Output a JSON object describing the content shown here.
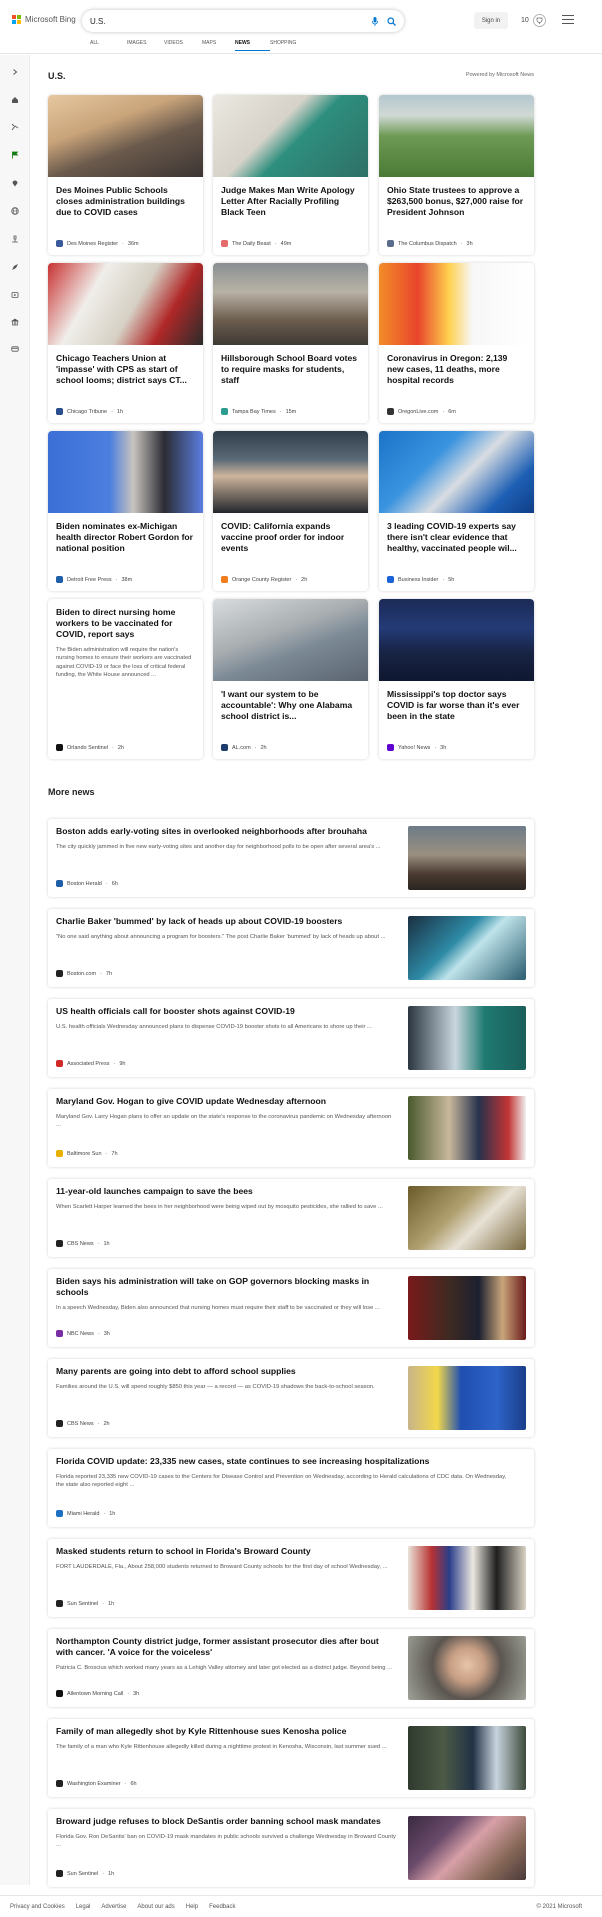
{
  "header": {
    "brand": "Microsoft Bing",
    "search_value": "U.S.",
    "signin": "Sign in",
    "rewards": "10"
  },
  "nav": [
    "ALL",
    "IMAGES",
    "VIDEOS",
    "MAPS",
    "NEWS",
    "SHOPPING"
  ],
  "section": {
    "title": "U.S.",
    "powered": "Powered by Microsoft News"
  },
  "cards": [
    {
      "title": "Des Moines Public Schools closes administration buildings due to COVID cases",
      "source": "Des Moines Register",
      "time": "36m"
    },
    {
      "title": "Judge Makes Man Write Apology Letter After Racially Profiling Black Teen",
      "source": "The Daily Beast",
      "time": "49m"
    },
    {
      "title": "Ohio State trustees to approve a $263,500 bonus, $27,000 raise for President Johnson",
      "source": "The Columbus Dispatch",
      "time": "3h"
    },
    {
      "title": "Chicago Teachers Union at 'impasse' with CPS as start of school looms; district says CT...",
      "source": "Chicago Tribune",
      "time": "1h"
    },
    {
      "title": "Hillsborough School Board votes to require masks for students, staff",
      "source": "Tampa Bay Times",
      "time": "15m"
    },
    {
      "title": "Coronavirus in Oregon: 2,139 new cases, 11 deaths, more hospital records",
      "source": "OregonLive.com",
      "time": "6m"
    },
    {
      "title": "Biden nominates ex-Michigan health director Robert Gordon for national position",
      "source": "Detroit Free Press",
      "time": "38m"
    },
    {
      "title": "COVID: California expands vaccine proof order for indoor events",
      "source": "Orange County Register",
      "time": "2h"
    },
    {
      "title": "3 leading COVID-19 experts say there isn't clear evidence that healthy, vaccinated people wil...",
      "source": "Business Insider",
      "time": "5h"
    },
    {
      "title": "Biden to direct nursing home workers to be vaccinated for COVID, report says",
      "description": "The Biden administration will require the nation's nursing homes to ensure their workers are vaccinated against COVID-19 or face the loss of critical federal funding, the White House announced ...",
      "source": "Orlando Sentinel",
      "time": "2h"
    },
    {
      "title": "'I want our system to be accountable': Why one Alabama school district is...",
      "source": "AL.com",
      "time": "2h"
    },
    {
      "title": "Mississippi's top doctor says COVID is far worse than it's ever been in the state",
      "source": "Yahoo! News",
      "time": "3h"
    }
  ],
  "more_title": "More news",
  "more": [
    {
      "title": "Boston adds early-voting sites in overlooked neighborhoods after brouhaha",
      "desc": "The city quickly jammed in five new early-voting sites and another day for neighborhood polls to be open after several area's ...",
      "source": "Boston Herald",
      "time": "6h"
    },
    {
      "title": "Charlie Baker 'bummed' by lack of heads up about COVID-19 boosters",
      "desc": "\"No one said anything about announcing a program for boosters.\" The post Charlie Baker 'bummed' by lack of heads up about ...",
      "source": "Boston.com",
      "time": "7h"
    },
    {
      "title": "US health officials call for booster shots against COVID-19",
      "desc": "U.S. health officials Wednesday announced plans to dispense COVID-19 booster shots to all Americans to shore up their ...",
      "source": "Associated Press",
      "time": "9h"
    },
    {
      "title": "Maryland Gov. Hogan to give COVID update Wednesday afternoon",
      "desc": "Maryland Gov. Larry Hogan plans to offer an update on the state's response to the coronavirus pandemic on Wednesday afternoon ...",
      "source": "Baltimore Sun",
      "time": "7h"
    },
    {
      "title": "11-year-old launches campaign to save the bees",
      "desc": "When Scarlett Harper learned the bees in her neighborhood were being wiped out by mosquito pesticides, she rallied to save ...",
      "source": "CBS News",
      "time": "1h"
    },
    {
      "title": "Biden says his administration will take on GOP governors blocking masks in schools",
      "desc": "In a speech Wednesday, Biden also announced that nursing homes must require their staff to be vaccinated or they will lose ...",
      "source": "NBC News",
      "time": "3h"
    },
    {
      "title": "Many parents are going into debt to afford school supplies",
      "desc": "Families around the U.S. will spend roughly $850 this year — a record — as COVID-19 shadows the back-to-school season.",
      "source": "CBS News",
      "time": "2h"
    },
    {
      "title": "Florida COVID update: 23,335 new cases, state continues to see increasing hospitalizations",
      "desc": "Florida reported 23,335 new COVID-19 cases to the Centers for Disease Control and Prevention on Wednesday, according to Herald calculations of CDC data. On Wednesday, the state also reported eight ...",
      "source": "Miami Herald",
      "time": "1h"
    },
    {
      "title": "Masked students return to school in Florida's Broward County",
      "desc": "FORT LAUDERDALE, Fla., About 258,000 students returned to Broward County schools for the first day of school Wednesday, ...",
      "source": "Sun Sentinel",
      "time": "1h"
    },
    {
      "title": "Northampton County district judge, former assistant prosecutor dies after bout with cancer. 'A voice for the voiceless'",
      "desc": "Patricia C. Broscius which worked many years as a Lehigh Valley attorney and later got elected as a district judge. Beyond being ...",
      "source": "Allentown Morning Call",
      "time": "3h"
    },
    {
      "title": "Family of man allegedly shot by Kyle Rittenhouse sues Kenosha police",
      "desc": "The family of a man who Kyle Rittenhouse allegedly killed during a nighttime protest in Kenosha, Wisconsin, last summer sued ...",
      "source": "Washington Examiner",
      "time": "6h"
    },
    {
      "title": "Broward judge refuses to block DeSantis order banning school mask mandates",
      "desc": "Florida Gov. Ron DeSantis' ban on COVID-19 mask mandates in public schools survived a challenge Wednesday in Broward County ...",
      "source": "Sun Sentinel",
      "time": "1h"
    }
  ],
  "footer": {
    "links": [
      "Privacy and Cookies",
      "Legal",
      "Advertise",
      "About our ads",
      "Help",
      "Feedback"
    ],
    "copyright": "© 2021 Microsoft"
  }
}
